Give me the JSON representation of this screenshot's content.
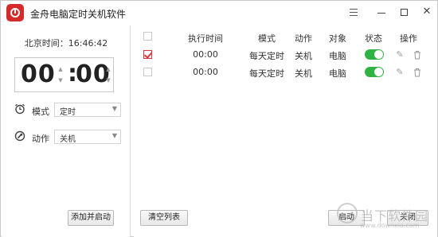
{
  "window": {
    "title": "金舟电脑定时关机软件"
  },
  "left": {
    "clock_label": "北京时间：16:46:42",
    "time_hours": "00",
    "time_colon": ":",
    "time_minutes": "00",
    "mode_label": "模式",
    "mode_value": "定时",
    "action_label": "动作",
    "action_value": "关机",
    "add_button": "添加并启动"
  },
  "table": {
    "headers": [
      "执行时间",
      "模式",
      "动作",
      "对象",
      "状态",
      "操作"
    ],
    "rows": [
      {
        "checked": true,
        "time": "00:00",
        "mode": "每天定时",
        "action": "关机",
        "target": "电脑",
        "enabled": true
      },
      {
        "checked": false,
        "time": "00:00",
        "mode": "每天定时",
        "action": "关机",
        "target": "电脑",
        "enabled": true
      }
    ]
  },
  "footer": {
    "clear_button": "清空列表",
    "start_button": "启动",
    "close_button": "关闭"
  },
  "watermark": {
    "text": "当下软件园",
    "url": "www.downxia.com"
  },
  "colors": {
    "brand": "#d42a2a",
    "toggle_on": "#2fb343",
    "check_mark": "#d43a3a"
  }
}
